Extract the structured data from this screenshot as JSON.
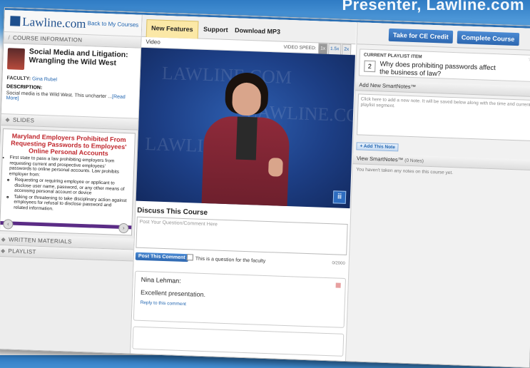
{
  "banner": {
    "text": "Presenter, Lawline.com"
  },
  "brand": {
    "logo": "Lawline.com"
  },
  "left": {
    "back_link": "Back to My Courses",
    "course_info_header": "COURSE INFORMATION",
    "course_title": "Social Media and Litigation: Wrangling the Wild West",
    "faculty_label": "FACULTY:",
    "faculty_name": "Gina Rubel",
    "description_label": "DESCRIPTION:",
    "description": "Social media is the Wild West. This uncharter ...",
    "read_more": "[Read More]",
    "slides_header": "SLIDES",
    "slide": {
      "title": "Maryland Employers Prohibited From Requesting Passwords to Employees' Online Personal Accounts",
      "bullet1": "First state to pass a law prohibiting employers from requesting current and prospective employees' passwords to online personal accounts. Law prohibits employer from:",
      "sub1": "Requesting or requiring employee or applicant to disclose user name, password, or any other means of accessing personal account or device",
      "sub2": "Taking or threatening to take disciplinary action against employees for refusal to disclose password and related information."
    },
    "written_header": "WRITTEN MATERIALS",
    "playlist_header": "PLAYLIST"
  },
  "tabs": [
    "New Features",
    "Support",
    "Download MP3"
  ],
  "video": {
    "label": "Video",
    "speed_label": "VIDEO SPEED:",
    "speeds": [
      "1x",
      "1.5x",
      "2x"
    ],
    "watermark": "LAWLINE.COM"
  },
  "discuss": {
    "title": "Discuss This Course",
    "placeholder": "Post Your Question/Comment Here",
    "post_button": "Post This Comment",
    "faculty_question": "This is a question for the faculty",
    "char_count": "0/2000",
    "comment_author": "Nina Lehman:",
    "comment_text": "Excellent presentation.",
    "reply_link": "Reply to this comment"
  },
  "right": {
    "ce_button": "Take for CE Credit",
    "complete_button": "Complete Course",
    "current_header": "CURRENT PLAYLIST ITEM",
    "current_num": "2",
    "current_title": "Why does prohibiting passwords affect the business of law?",
    "add_notes_header": "Add New SmartNotes™",
    "note_placeholder": "Click here to add a new note. It will be saved below along with the time and current playlist segment.",
    "add_note_button": "+ Add This Note",
    "view_notes_header": "View SmartNotes™",
    "notes_count": "(0 Notes)",
    "no_notes": "You haven't taken any notes on this course yet."
  }
}
